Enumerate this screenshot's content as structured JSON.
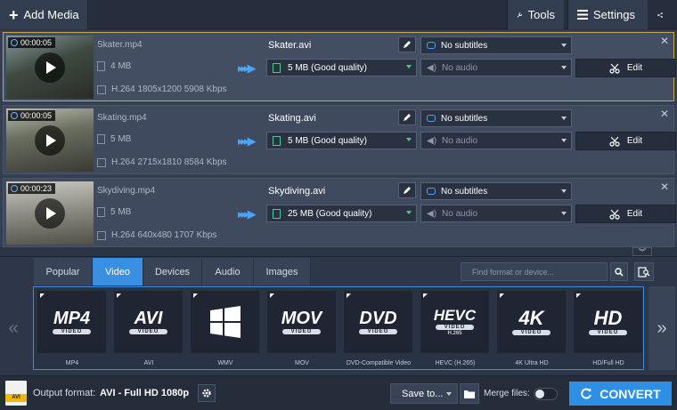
{
  "toolbar": {
    "add_media_label": "Add Media",
    "tools_label": "Tools",
    "settings_label": "Settings"
  },
  "files": [
    {
      "duration": "00:00:05",
      "source_name": "Skater.mp4",
      "source_size": "4 MB",
      "source_info": "H.264 1805x1200 5908 Kbps",
      "output_name": "Skater.avi",
      "output_size": "5 MB (Good quality)",
      "subtitles": "No subtitles",
      "audio": "No audio",
      "edit_label": "Edit",
      "selected": true
    },
    {
      "duration": "00:00:05",
      "source_name": "Skating.mp4",
      "source_size": "5 MB",
      "source_info": "H.264 2715x1810 8584 Kbps",
      "output_name": "Skating.avi",
      "output_size": "5 MB (Good quality)",
      "subtitles": "No subtitles",
      "audio": "No audio",
      "edit_label": "Edit",
      "selected": false
    },
    {
      "duration": "00:00:23",
      "source_name": "Skydiving.mp4",
      "source_size": "5 MB",
      "source_info": "H.264 640x480 1707 Kbps",
      "output_name": "Skydiving.avi",
      "output_size": "25 MB (Good quality)",
      "subtitles": "No subtitles",
      "audio": "No audio",
      "edit_label": "Edit",
      "selected": false
    }
  ],
  "format_tabs": [
    "Popular",
    "Video",
    "Devices",
    "Audio",
    "Images"
  ],
  "active_tab": "Video",
  "search": {
    "placeholder": "Find format or device..."
  },
  "formats": [
    {
      "logo": "MP4",
      "badge": "VIDEO",
      "label": "MP4"
    },
    {
      "logo": "AVI",
      "badge": "VIDEO",
      "label": "AVI"
    },
    {
      "logo": "windows-logo",
      "badge": "",
      "label": "WMV"
    },
    {
      "logo": "MOV",
      "badge": "VIDEO",
      "label": "MOV"
    },
    {
      "logo": "DVD",
      "badge": "VIDEO",
      "label": "DVD-Compatible Video"
    },
    {
      "logo": "HEVC",
      "badge": "VIDEO",
      "sub": "H.265",
      "label": "HEVC (H.265)"
    },
    {
      "logo": "4K",
      "badge": "VIDEO",
      "label": "4K Ultra HD"
    },
    {
      "logo": "HD",
      "badge": "VIDEO",
      "label": "HD/Full HD"
    }
  ],
  "bottom": {
    "format_icon_text": "AVI",
    "output_format_label": "Output format:",
    "output_format_value": "AVI - Full HD 1080p",
    "save_to_label": "Save to...",
    "merge_label": "Merge files:",
    "merge_enabled": false,
    "convert_label": "CONVERT"
  },
  "colors": {
    "accent": "#2d8fe6",
    "selected_border": "#c9a94a",
    "quality_green": "#3fcf8e"
  }
}
